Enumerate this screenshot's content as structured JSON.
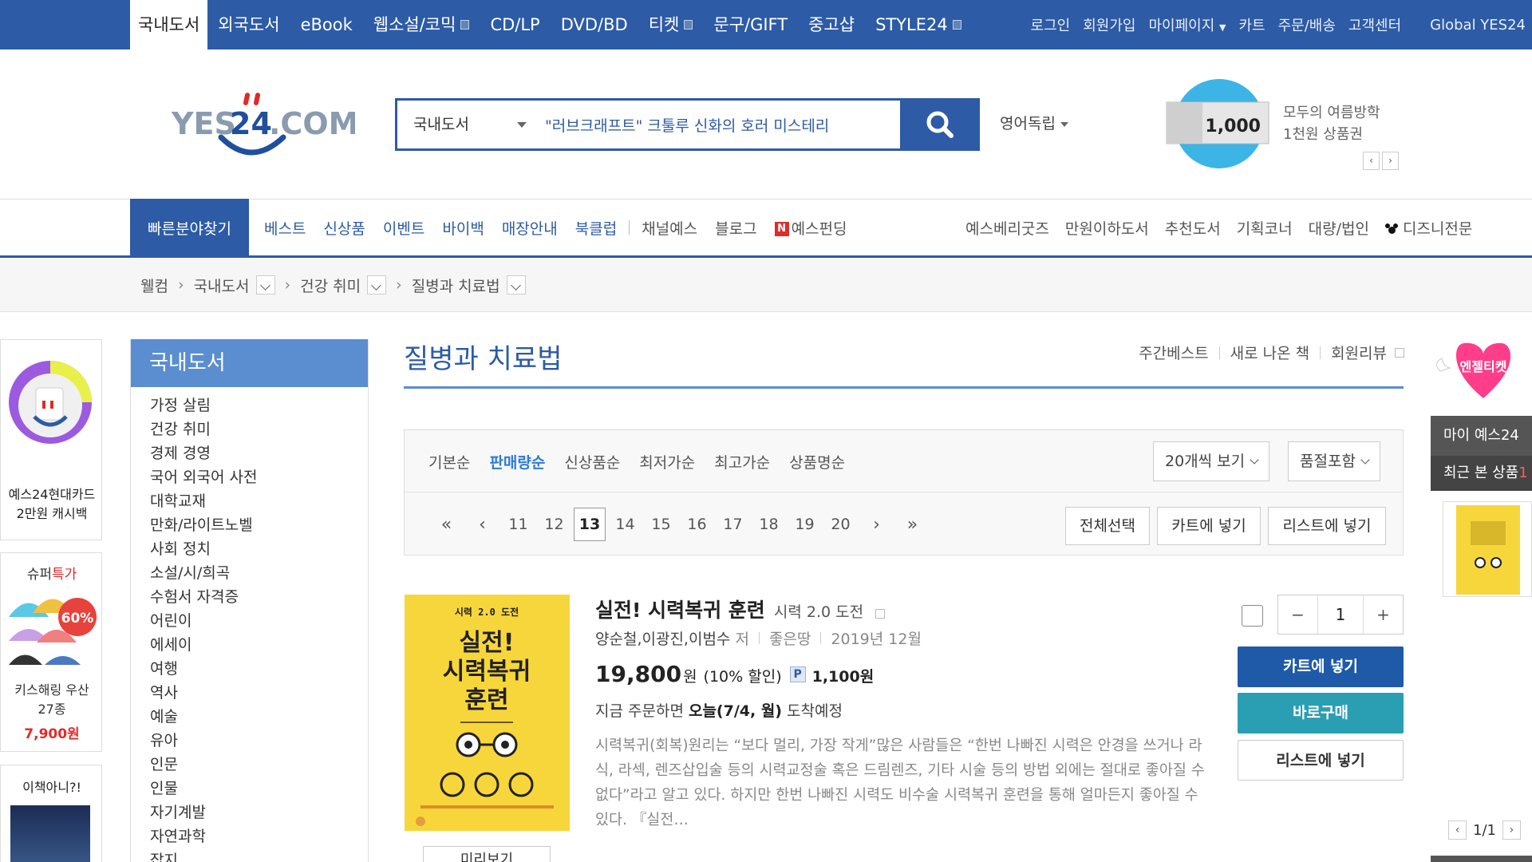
{
  "top_nav": {
    "items": [
      "국내도서",
      "외국도서",
      "eBook",
      "웹소설/코믹",
      "CD/LP",
      "DVD/BD",
      "티켓",
      "문구/GIFT",
      "중고샵",
      "STYLE24"
    ],
    "active": "국내도서"
  },
  "user_nav": {
    "items": [
      "로그인",
      "회원가입",
      "마이페이지",
      "카트",
      "주문/배송",
      "고객센터"
    ],
    "global": "Global YES24"
  },
  "logo": {
    "text_left": "YES",
    "text_num": "24",
    "text_right": ".COM"
  },
  "search": {
    "category": "국내도서",
    "value": "\"러브크래프트\" 크툴루 신화의 호러 미스테리",
    "button_label": "search"
  },
  "lang_select": "영어독립",
  "promo": {
    "amount": "1,000",
    "line1": "모두의 여름방학",
    "line2": "1천원 상품권"
  },
  "category_nav": {
    "quick_find": "빠른분야찾기",
    "left": [
      "베스트",
      "신상품",
      "이벤트",
      "바이백",
      "매장안내",
      "북클럽"
    ],
    "left_gray": [
      "채널예스",
      "블로그"
    ],
    "funding": "예스펀딩",
    "right": [
      "예스베리굿즈",
      "만원이하도서",
      "추천도서",
      "기획코너",
      "대량/법인",
      "디즈니전문"
    ]
  },
  "breadcrumb": [
    "웰컴",
    "국내도서",
    "건강 취미",
    "질병과 치료법"
  ],
  "left_ads": {
    "card_text": "예스24현대카드 2만원 캐시백",
    "super_label": "슈퍼",
    "super_label_accent": "특가",
    "super_badge": "60%",
    "super_item": "키스해링 우산27종",
    "super_price": "7,900원",
    "third_title": "이책아니?!"
  },
  "sidebar": {
    "title": "국내도서",
    "categories": [
      "가정 살림",
      "건강 취미",
      "경제 경영",
      "국어 외국어 사전",
      "대학교재",
      "만화/라이트노벨",
      "사회 정치",
      "소설/시/희곡",
      "수험서 자격증",
      "어린이",
      "에세이",
      "여행",
      "역사",
      "예술",
      "유아",
      "인문",
      "인물",
      "자기계발",
      "자연과학",
      "잡지"
    ]
  },
  "main": {
    "title": "질병과 치료법",
    "title_links": [
      "주간베스트",
      "새로 나온 책",
      "회원리뷰"
    ],
    "sort_options": [
      "기본순",
      "판매량순",
      "신상품순",
      "최저가순",
      "최고가순",
      "상품명순"
    ],
    "sort_active": "판매량순",
    "per_page": "20개씩 보기",
    "soldout": "품절포함",
    "pages": [
      "11",
      "12",
      "13",
      "14",
      "15",
      "16",
      "17",
      "18",
      "19",
      "20"
    ],
    "current_page": "13",
    "actions": [
      "전체선택",
      "카트에 넣기",
      "리스트에 넣기"
    ]
  },
  "product": {
    "cover_top": "시력 2.0 도전",
    "cover_title1": "실전!",
    "cover_title2": "시력복귀",
    "cover_title3": "훈련",
    "preview": "미리보기",
    "title": "실전! 시력복귀 훈련",
    "subtitle": "시력 2.0 도전",
    "authors": "양순철,이광진,이범수",
    "author_role": "저",
    "publisher": "좋은땅",
    "date": "2019년 12월",
    "price": "19,800",
    "won": "원",
    "discount": "(10% 할인)",
    "points_badge": "P",
    "points": "1,100원",
    "delivery_prefix": "지금 주문하면",
    "delivery_day": "오늘(7/4, 월)",
    "delivery_suffix": "도착예정",
    "description": "시력복귀(회복)원리는 “보다 멀리, 가장 작게”많은 사람들은 “한번 나빠진 시력은 안경을 쓰거나 라식, 라섹, 렌즈삽입술 등의 시력교정술 혹은 드림렌즈, 기타 시술 등의 방법 외에는 절대로 좋아질 수 없다”라고 알고 있다. 하지만 한번 나빠진 시력도 비수술 시력복귀 훈련을 통해 얼마든지 좋아질 수 있다. 『실전…",
    "qty": "1",
    "qty_minus": "−",
    "qty_plus": "+",
    "btn_cart": "카트에 넣기",
    "btn_buy": "바로구매",
    "btn_list": "리스트에 넣기"
  },
  "right_rail": {
    "angel": "엔젤티켓",
    "my_yes": "마이 예스24",
    "recent": "최근 본 상품",
    "recent_count": "1",
    "pager": "1/1"
  },
  "colors": {
    "brand_blue": "#2d5ba5",
    "sidebar_head": "#5a8ed0",
    "cart_btn": "#1f5aa8",
    "buy_btn": "#2a9fb3",
    "accent_red": "#e02a2a",
    "cover_yellow": "#f7d63c"
  }
}
